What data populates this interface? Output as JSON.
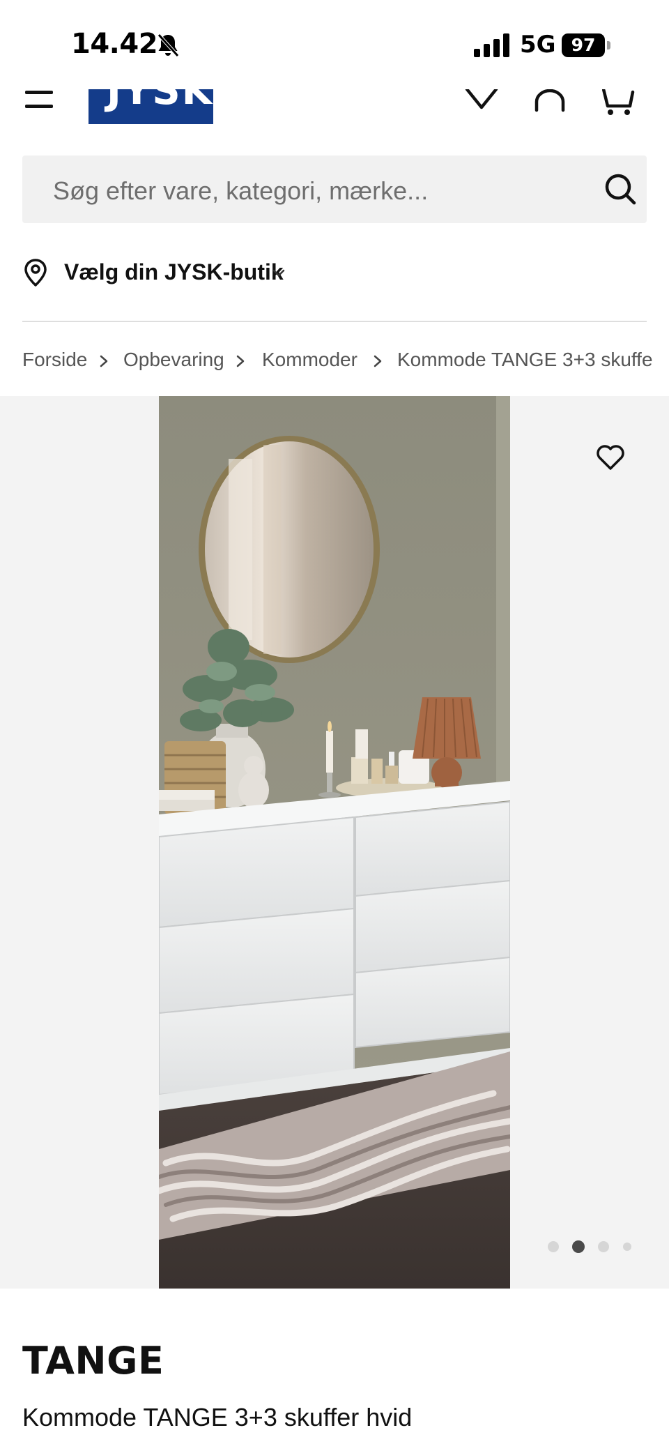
{
  "status_bar": {
    "time": "14.42",
    "network": "5G",
    "battery": "97"
  },
  "header": {
    "logo_text": "JYSK"
  },
  "search": {
    "placeholder": "Søg efter vare, kategori, mærke..."
  },
  "store": {
    "label": "Vælg din JYSK-butik"
  },
  "breadcrumb": {
    "items": [
      "Forside",
      "Opbevaring",
      "Kommoder",
      "Kommode TANGE 3+3 skuffe"
    ]
  },
  "gallery": {
    "image_count": 4,
    "active_index": 1
  },
  "product": {
    "brand": "TANGE",
    "name": "Kommode TANGE 3+3 skuffer hvid"
  },
  "colors": {
    "brand_blue": "#143c8a",
    "search_bg": "#f1f1f1",
    "gallery_bg": "#f3f3f3"
  },
  "icons": [
    "bell-off-icon",
    "signal-icon",
    "battery-icon",
    "menu-icon",
    "chevron-down-icon",
    "user-icon",
    "cart-icon",
    "search-icon",
    "location-pin-icon",
    "heart-icon"
  ]
}
